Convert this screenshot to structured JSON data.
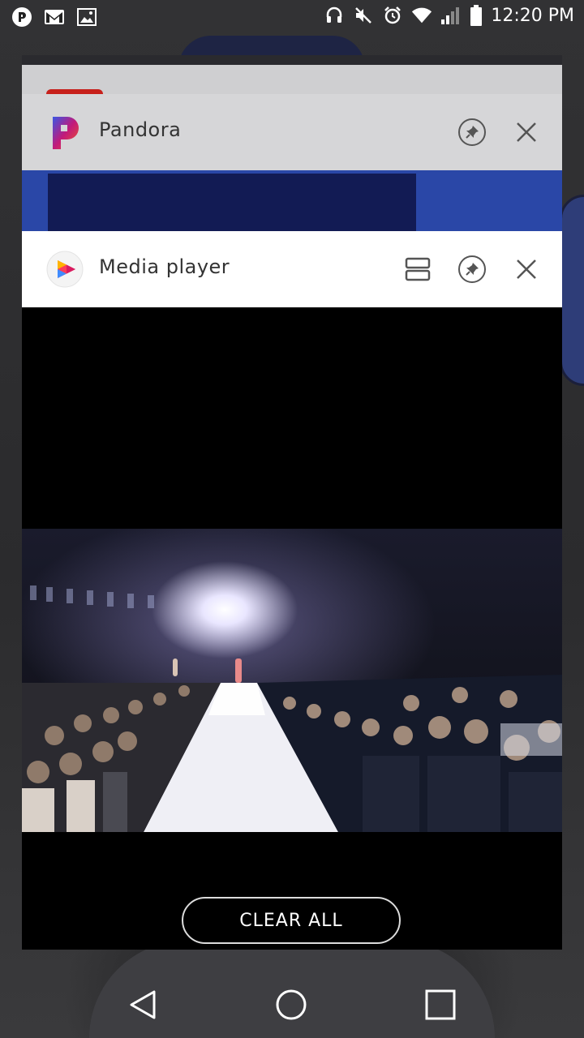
{
  "status_bar": {
    "left_icons": [
      "pandora-notification-icon",
      "gmail-icon",
      "gallery-icon"
    ],
    "right_icons": [
      "headphones-icon",
      "mute-icon",
      "alarm-icon",
      "wifi-icon",
      "signal-icon",
      "battery-icon"
    ],
    "time": "12:20 PM"
  },
  "recents": {
    "cards": [
      {
        "id": "back-card",
        "title": "",
        "accent": "#c7201b"
      },
      {
        "id": "pandora",
        "title": "Pandora",
        "icon": "pandora-app-icon",
        "header_bg": "#d6d6d8",
        "preview_color": "#2a47a7"
      },
      {
        "id": "media-player",
        "title": "Media player",
        "icon": "media-player-app-icon",
        "header_bg": "#ffffff"
      }
    ],
    "clear_all_label": "CLEAR ALL"
  },
  "nav_bar": {
    "buttons": [
      "back-icon",
      "home-icon",
      "recents-icon"
    ]
  }
}
